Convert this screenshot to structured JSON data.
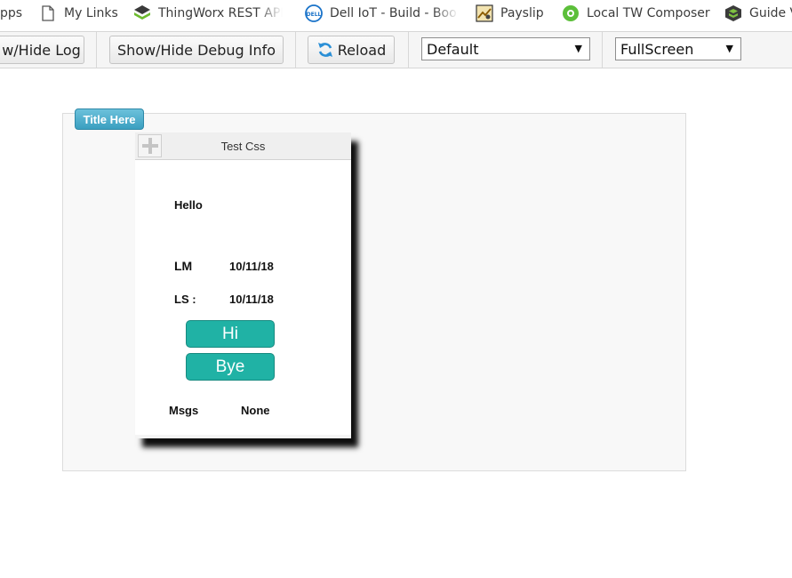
{
  "bookmarks": [
    {
      "label": "pps",
      "icon": "apps-grid-icon"
    },
    {
      "label": "My Links",
      "icon": "page-icon"
    },
    {
      "label": "ThingWorx REST API",
      "icon": "thingworx-icon"
    },
    {
      "label": "Dell IoT - Build - Boo",
      "icon": "dell-icon"
    },
    {
      "label": "Payslip",
      "icon": "payslip-icon"
    },
    {
      "label": "Local TW Composer",
      "icon": "composer-icon"
    },
    {
      "label": "Guide V",
      "icon": "guide-icon"
    }
  ],
  "toolbar": {
    "log_label": "w/Hide Log",
    "debug_label": "Show/Hide Debug Info",
    "reload_label": "Reload",
    "theme_select": "Default",
    "view_select": "FullScreen"
  },
  "mashup": {
    "title_badge": "Title Here",
    "panel": {
      "title": "Test Css",
      "hello_label": "Hello",
      "lm_label": "LM",
      "lm_value": "10/11/18",
      "ls_label": "LS :",
      "ls_value": "10/11/18",
      "hi_button": "Hi",
      "bye_button": "Bye",
      "msgs_label": "Msgs",
      "msgs_value": "None"
    }
  },
  "colors": {
    "accent_teal": "#20b2a5",
    "badge_blue": "#3a9fc0"
  }
}
